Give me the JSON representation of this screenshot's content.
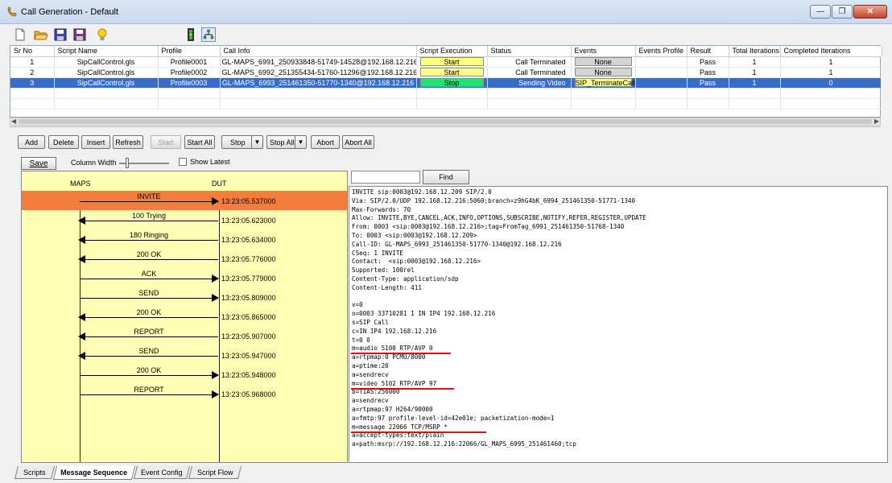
{
  "window": {
    "title": "Call Generation  - Default",
    "minimize": "—",
    "maximize": "❐",
    "close": "✕"
  },
  "grid": {
    "columns": [
      "Sr No",
      "Script Name",
      "Profile",
      "Call Info",
      "Script Execution",
      "Status",
      "Events",
      "Events Profile",
      "Result",
      "Total Iterations",
      "Completed Iterations"
    ],
    "rows": [
      {
        "sr": "1",
        "script": "SipCallControl.gls",
        "profile": "Profile0001",
        "info": "GL-MAPS_6991_250933848-51749-14528@192.168.12.216",
        "exec": "Start",
        "status": "Call Terminated",
        "events": "None",
        "events_profile": "",
        "result": "Pass",
        "total": "1",
        "completed": "1"
      },
      {
        "sr": "2",
        "script": "SipCallControl.gls",
        "profile": "Profile0002",
        "info": "GL-MAPS_6992_251355434-51760-11296@192.168.12.216",
        "exec": "Start",
        "status": "Call Terminated",
        "events": "None",
        "events_profile": "",
        "result": "Pass",
        "total": "1",
        "completed": "1"
      },
      {
        "sr": "3",
        "script": "SipCallControl.gls",
        "profile": "Profile0003",
        "info": "GL-MAPS_6993_251461350-51770-1340@192.168.12.216",
        "exec": "Stop",
        "status": "Sending Video",
        "events": "SIP_TerminateCall",
        "events_profile": "",
        "result": "Pass",
        "total": "1",
        "completed": "0"
      }
    ]
  },
  "actions": {
    "add": "Add",
    "delete": "Delete",
    "insert": "Insert",
    "refresh": "Refresh",
    "start": "Start",
    "start_all": "Start All",
    "stop": "Stop",
    "stop_all": "Stop All",
    "abort": "Abort",
    "abort_all": "Abort All"
  },
  "options": {
    "save": "Save",
    "column_width": "Column Width",
    "show_latest": "Show Latest"
  },
  "sequence": {
    "left": "MAPS",
    "right": "DUT",
    "messages": [
      {
        "label": "INVITE",
        "dir": "right",
        "ts": "13:23:05.537000",
        "highlight": true
      },
      {
        "label": "100  Trying",
        "dir": "left",
        "ts": "13:23:05.623000"
      },
      {
        "label": "180  Ringing",
        "dir": "left",
        "ts": "13:23:05.634000"
      },
      {
        "label": "200  OK",
        "dir": "left",
        "ts": "13:23:05.776000"
      },
      {
        "label": "ACK",
        "dir": "right",
        "ts": "13:23:05.779000"
      },
      {
        "label": "SEND",
        "dir": "right",
        "ts": "13:23:05.809000"
      },
      {
        "label": "200 OK",
        "dir": "left",
        "ts": "13:23:05.865000"
      },
      {
        "label": "REPORT",
        "dir": "left",
        "ts": "13:23:05.907000"
      },
      {
        "label": "SEND",
        "dir": "left",
        "ts": "13:23:05.947000"
      },
      {
        "label": "200 OK",
        "dir": "right",
        "ts": "13:23:05.948000"
      },
      {
        "label": "REPORT",
        "dir": "right",
        "ts": "13:23:05.968000"
      }
    ]
  },
  "find": {
    "button": "Find",
    "value": ""
  },
  "detail_lines": [
    "INVITE sip:0003@192.168.12.209 SIP/2.0",
    "Via: SIP/2.0/UDP 192.168.12.216:5060;branch=z9hG4bK_6994_251461350-51771-1340",
    "Max-Forwards: 70",
    "Allow: INVITE,BYE,CANCEL,ACK,INFO,OPTIONS,SUBSCRIBE,NOTIFY,REFER,REGISTER,UPDATE",
    "From: 0003 <sip:0003@192.168.12.216>;tag=FromTag_6991_251461350-51768-1340",
    "To: 0003 <sip:0003@192.168.12.209>",
    "Call-ID: GL-MAPS_6993_251461350-51770-1340@192.168.12.216",
    "CSeq: 1 INVITE",
    "Contact:  <sip:0003@192.168.12.216>",
    "Supported: 100rel",
    "Content-Type: application/sdp",
    "Content-Length: 411",
    "",
    "v=0",
    "o=0003 33710281 1 IN IP4 192.168.12.216",
    "s=SIP Call",
    "c=IN IP4 192.168.12.216",
    "t=0 0",
    "m=audio 5100 RTP/AVP 0",
    "a=rtpmap:0 PCMU/8000",
    "a=ptime:20",
    "a=sendrecv",
    "m=video 5102 RTP/AVP 97",
    "b=TIAS:256000",
    "a=sendrecv",
    "a=rtpmap:97 H264/90000",
    "a=fmtp:97 profile-level-id=42e01e; packetization-mode=1",
    "m=message 22066 TCP/MSRP *",
    "a=accept-types:text/plain",
    "a=path:msrp://192.168.12.216:22066/GL_MAPS_6995_251461460;tcp"
  ],
  "tabs": [
    "Scripts",
    "Message Sequence",
    "Event Config",
    "Script Flow"
  ],
  "colors": {
    "selection": "#3b6cc3",
    "start": "#ffff80",
    "stop": "#21e36e",
    "highlight_row": "#f47d3b",
    "diagram_bg": "#ffffb4",
    "underline": "#e01010"
  }
}
